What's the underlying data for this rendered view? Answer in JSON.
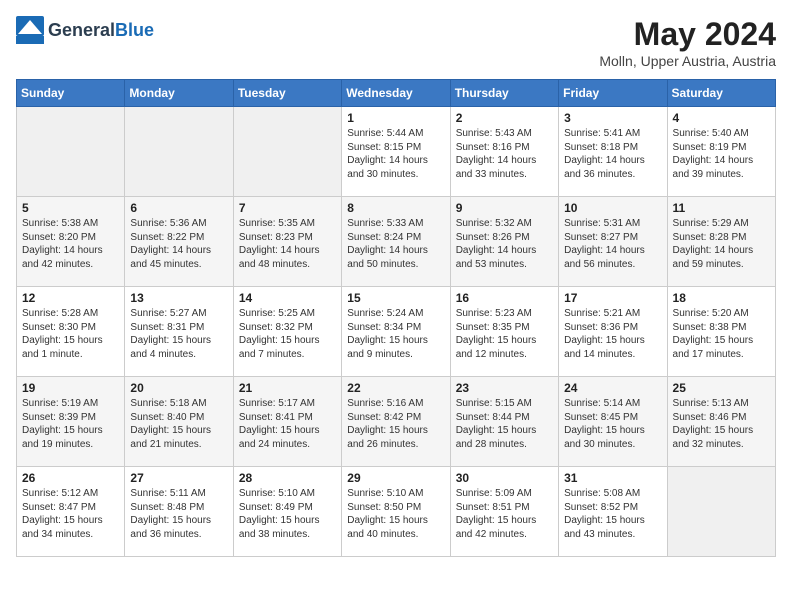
{
  "header": {
    "logo_general": "General",
    "logo_blue": "Blue",
    "month_year": "May 2024",
    "location": "Molln, Upper Austria, Austria"
  },
  "days_of_week": [
    "Sunday",
    "Monday",
    "Tuesday",
    "Wednesday",
    "Thursday",
    "Friday",
    "Saturday"
  ],
  "weeks": [
    {
      "days": [
        {
          "num": "",
          "content": ""
        },
        {
          "num": "",
          "content": ""
        },
        {
          "num": "",
          "content": ""
        },
        {
          "num": "1",
          "content": "Sunrise: 5:44 AM\nSunset: 8:15 PM\nDaylight: 14 hours\nand 30 minutes."
        },
        {
          "num": "2",
          "content": "Sunrise: 5:43 AM\nSunset: 8:16 PM\nDaylight: 14 hours\nand 33 minutes."
        },
        {
          "num": "3",
          "content": "Sunrise: 5:41 AM\nSunset: 8:18 PM\nDaylight: 14 hours\nand 36 minutes."
        },
        {
          "num": "4",
          "content": "Sunrise: 5:40 AM\nSunset: 8:19 PM\nDaylight: 14 hours\nand 39 minutes."
        }
      ]
    },
    {
      "days": [
        {
          "num": "5",
          "content": "Sunrise: 5:38 AM\nSunset: 8:20 PM\nDaylight: 14 hours\nand 42 minutes."
        },
        {
          "num": "6",
          "content": "Sunrise: 5:36 AM\nSunset: 8:22 PM\nDaylight: 14 hours\nand 45 minutes."
        },
        {
          "num": "7",
          "content": "Sunrise: 5:35 AM\nSunset: 8:23 PM\nDaylight: 14 hours\nand 48 minutes."
        },
        {
          "num": "8",
          "content": "Sunrise: 5:33 AM\nSunset: 8:24 PM\nDaylight: 14 hours\nand 50 minutes."
        },
        {
          "num": "9",
          "content": "Sunrise: 5:32 AM\nSunset: 8:26 PM\nDaylight: 14 hours\nand 53 minutes."
        },
        {
          "num": "10",
          "content": "Sunrise: 5:31 AM\nSunset: 8:27 PM\nDaylight: 14 hours\nand 56 minutes."
        },
        {
          "num": "11",
          "content": "Sunrise: 5:29 AM\nSunset: 8:28 PM\nDaylight: 14 hours\nand 59 minutes."
        }
      ]
    },
    {
      "days": [
        {
          "num": "12",
          "content": "Sunrise: 5:28 AM\nSunset: 8:30 PM\nDaylight: 15 hours\nand 1 minute."
        },
        {
          "num": "13",
          "content": "Sunrise: 5:27 AM\nSunset: 8:31 PM\nDaylight: 15 hours\nand 4 minutes."
        },
        {
          "num": "14",
          "content": "Sunrise: 5:25 AM\nSunset: 8:32 PM\nDaylight: 15 hours\nand 7 minutes."
        },
        {
          "num": "15",
          "content": "Sunrise: 5:24 AM\nSunset: 8:34 PM\nDaylight: 15 hours\nand 9 minutes."
        },
        {
          "num": "16",
          "content": "Sunrise: 5:23 AM\nSunset: 8:35 PM\nDaylight: 15 hours\nand 12 minutes."
        },
        {
          "num": "17",
          "content": "Sunrise: 5:21 AM\nSunset: 8:36 PM\nDaylight: 15 hours\nand 14 minutes."
        },
        {
          "num": "18",
          "content": "Sunrise: 5:20 AM\nSunset: 8:38 PM\nDaylight: 15 hours\nand 17 minutes."
        }
      ]
    },
    {
      "days": [
        {
          "num": "19",
          "content": "Sunrise: 5:19 AM\nSunset: 8:39 PM\nDaylight: 15 hours\nand 19 minutes."
        },
        {
          "num": "20",
          "content": "Sunrise: 5:18 AM\nSunset: 8:40 PM\nDaylight: 15 hours\nand 21 minutes."
        },
        {
          "num": "21",
          "content": "Sunrise: 5:17 AM\nSunset: 8:41 PM\nDaylight: 15 hours\nand 24 minutes."
        },
        {
          "num": "22",
          "content": "Sunrise: 5:16 AM\nSunset: 8:42 PM\nDaylight: 15 hours\nand 26 minutes."
        },
        {
          "num": "23",
          "content": "Sunrise: 5:15 AM\nSunset: 8:44 PM\nDaylight: 15 hours\nand 28 minutes."
        },
        {
          "num": "24",
          "content": "Sunrise: 5:14 AM\nSunset: 8:45 PM\nDaylight: 15 hours\nand 30 minutes."
        },
        {
          "num": "25",
          "content": "Sunrise: 5:13 AM\nSunset: 8:46 PM\nDaylight: 15 hours\nand 32 minutes."
        }
      ]
    },
    {
      "days": [
        {
          "num": "26",
          "content": "Sunrise: 5:12 AM\nSunset: 8:47 PM\nDaylight: 15 hours\nand 34 minutes."
        },
        {
          "num": "27",
          "content": "Sunrise: 5:11 AM\nSunset: 8:48 PM\nDaylight: 15 hours\nand 36 minutes."
        },
        {
          "num": "28",
          "content": "Sunrise: 5:10 AM\nSunset: 8:49 PM\nDaylight: 15 hours\nand 38 minutes."
        },
        {
          "num": "29",
          "content": "Sunrise: 5:10 AM\nSunset: 8:50 PM\nDaylight: 15 hours\nand 40 minutes."
        },
        {
          "num": "30",
          "content": "Sunrise: 5:09 AM\nSunset: 8:51 PM\nDaylight: 15 hours\nand 42 minutes."
        },
        {
          "num": "31",
          "content": "Sunrise: 5:08 AM\nSunset: 8:52 PM\nDaylight: 15 hours\nand 43 minutes."
        },
        {
          "num": "",
          "content": ""
        }
      ]
    }
  ]
}
